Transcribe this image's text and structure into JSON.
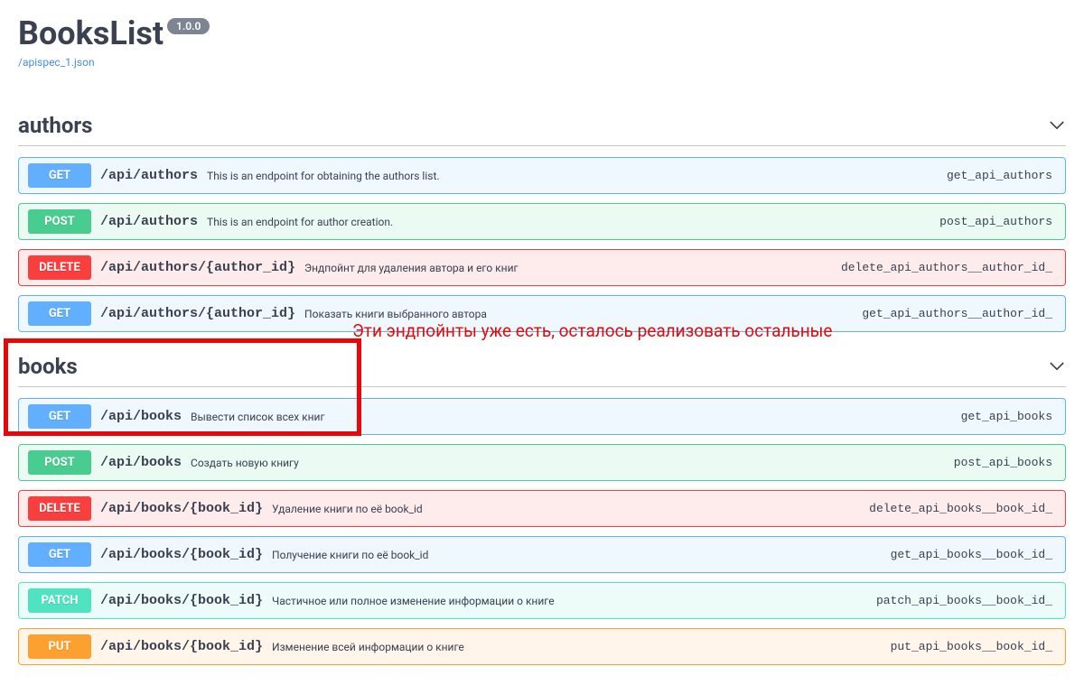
{
  "header": {
    "title": "BooksList",
    "version": "1.0.0",
    "spec_link": "/apispec_1.json"
  },
  "annotation": {
    "text": "Эти эндпойнты уже есть, осталось реализовать остальные"
  },
  "tags": [
    {
      "name": "authors",
      "ops": [
        {
          "method": "GET",
          "path": "/api/authors",
          "summary": "This is an endpoint for obtaining the authors list.",
          "opId": "get_api_authors"
        },
        {
          "method": "POST",
          "path": "/api/authors",
          "summary": "This is an endpoint for author creation.",
          "opId": "post_api_authors"
        },
        {
          "method": "DELETE",
          "path": "/api/authors/{author_id}",
          "summary": "Эндпойнт для удаления автора и его книг",
          "opId": "delete_api_authors__author_id_"
        },
        {
          "method": "GET",
          "path": "/api/authors/{author_id}",
          "summary": "Показать книги выбранного автора",
          "opId": "get_api_authors__author_id_"
        }
      ]
    },
    {
      "name": "books",
      "ops": [
        {
          "method": "GET",
          "path": "/api/books",
          "summary": "Вывести список всех книг",
          "opId": "get_api_books"
        },
        {
          "method": "POST",
          "path": "/api/books",
          "summary": "Создать новую книгу",
          "opId": "post_api_books"
        },
        {
          "method": "DELETE",
          "path": "/api/books/{book_id}",
          "summary": "Удаление книги по её book_id",
          "opId": "delete_api_books__book_id_"
        },
        {
          "method": "GET",
          "path": "/api/books/{book_id}",
          "summary": "Получение книги по её book_id",
          "opId": "get_api_books__book_id_"
        },
        {
          "method": "PATCH",
          "path": "/api/books/{book_id}",
          "summary": "Частичное или полное изменение информации о книге",
          "opId": "patch_api_books__book_id_"
        },
        {
          "method": "PUT",
          "path": "/api/books/{book_id}",
          "summary": "Изменение всей информации о книге",
          "opId": "put_api_books__book_id_"
        }
      ]
    }
  ]
}
